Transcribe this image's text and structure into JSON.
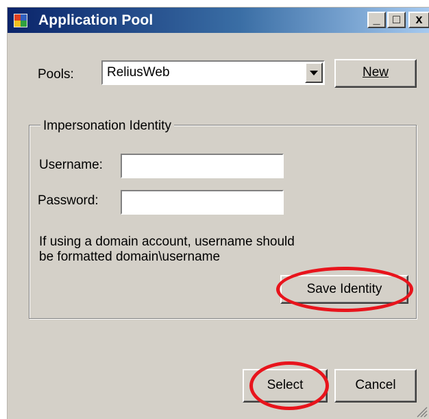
{
  "window": {
    "title": "Application Pool",
    "controls": {
      "minimize": "_",
      "maximize": "□",
      "close": "x"
    }
  },
  "pools": {
    "label": "Pools:",
    "selected": "ReliusWeb",
    "new_button": "New"
  },
  "identity": {
    "group_title": "Impersonation Identity",
    "username_label": "Username:",
    "username_value": "",
    "password_label": "Password:",
    "password_value": "",
    "note_line1": "If using a domain account, username should",
    "note_line2": "be formatted domain\\username",
    "save_button": "Save Identity"
  },
  "footer": {
    "select_button": "Select",
    "cancel_button": "Cancel"
  },
  "colors": {
    "title_gradient_start": "#0a246a",
    "title_gradient_end": "#a6caf0",
    "dialog_background": "#d4d0c8",
    "highlight_circle": "#e8141c"
  },
  "icons": [
    "app-window-icon",
    "minimize-icon",
    "maximize-icon",
    "close-icon",
    "dropdown-arrow-icon",
    "resize-grip-icon"
  ]
}
